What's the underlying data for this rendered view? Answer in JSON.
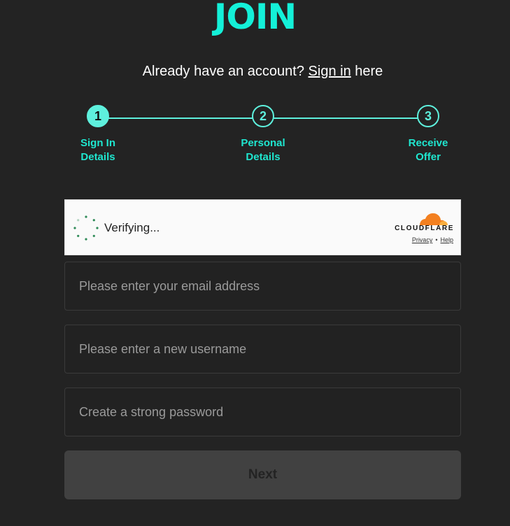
{
  "header": {
    "title": "JOIN",
    "account_prompt": "Already have an account?",
    "signin_link": "Sign in",
    "account_suffix": "here"
  },
  "stepper": {
    "accent_color": "#5ef0dd",
    "current_step": 1,
    "steps": [
      {
        "number": "1",
        "label_line1": "Sign In",
        "label_line2": "Details"
      },
      {
        "number": "2",
        "label_line1": "Personal",
        "label_line2": "Details"
      },
      {
        "number": "3",
        "label_line1": "Receive",
        "label_line2": "Offer"
      }
    ]
  },
  "captcha": {
    "status": "Verifying...",
    "brand": "CLOUDFLARE",
    "privacy_link": "Privacy",
    "separator": "•",
    "help_link": "Help",
    "icon": "cloudflare-cloud-icon",
    "spinner_icon": "loading-spinner-icon"
  },
  "form": {
    "email_placeholder": "Please enter your email address",
    "email_value": "",
    "username_placeholder": "Please enter a new username",
    "username_value": "",
    "password_placeholder": "Create a strong password",
    "password_value": "",
    "next_label": "Next"
  }
}
